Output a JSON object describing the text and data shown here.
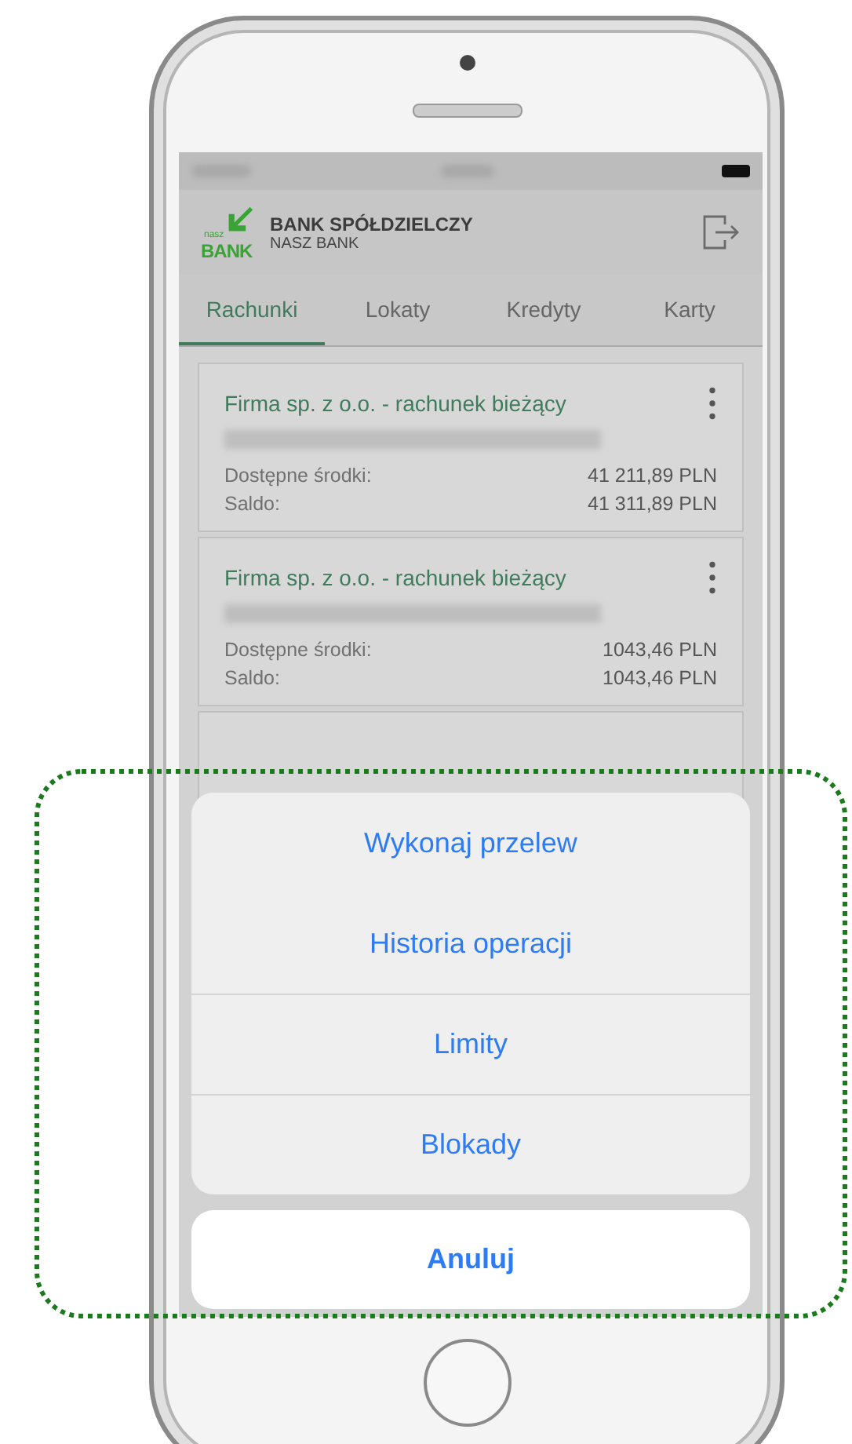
{
  "header": {
    "logo_small": "nasz",
    "logo_big": "BANK",
    "name": "BANK SPÓŁDZIELCZY",
    "subtitle": "NASZ BANK"
  },
  "tabs": [
    {
      "label": "Rachunki",
      "selected": true
    },
    {
      "label": "Lokaty",
      "selected": false
    },
    {
      "label": "Kredyty",
      "selected": false
    },
    {
      "label": "Karty",
      "selected": false
    }
  ],
  "accounts": [
    {
      "title": "Firma sp. z o.o. - rachunek bieżący",
      "rows": [
        {
          "label": "Dostępne środki:",
          "value": "41 211,89 PLN"
        },
        {
          "label": "Saldo:",
          "value": "41 311,89 PLN"
        }
      ]
    },
    {
      "title": "Firma sp. z o.o. - rachunek bieżący",
      "rows": [
        {
          "label": "Dostępne środki:",
          "value": "1043,46 PLN"
        },
        {
          "label": "Saldo:",
          "value": "1043,46 PLN"
        }
      ]
    }
  ],
  "action_sheet": {
    "actions": [
      "Wykonaj przelew",
      "Historia operacji",
      "Limity",
      "Blokady"
    ],
    "cancel": "Anuluj"
  }
}
